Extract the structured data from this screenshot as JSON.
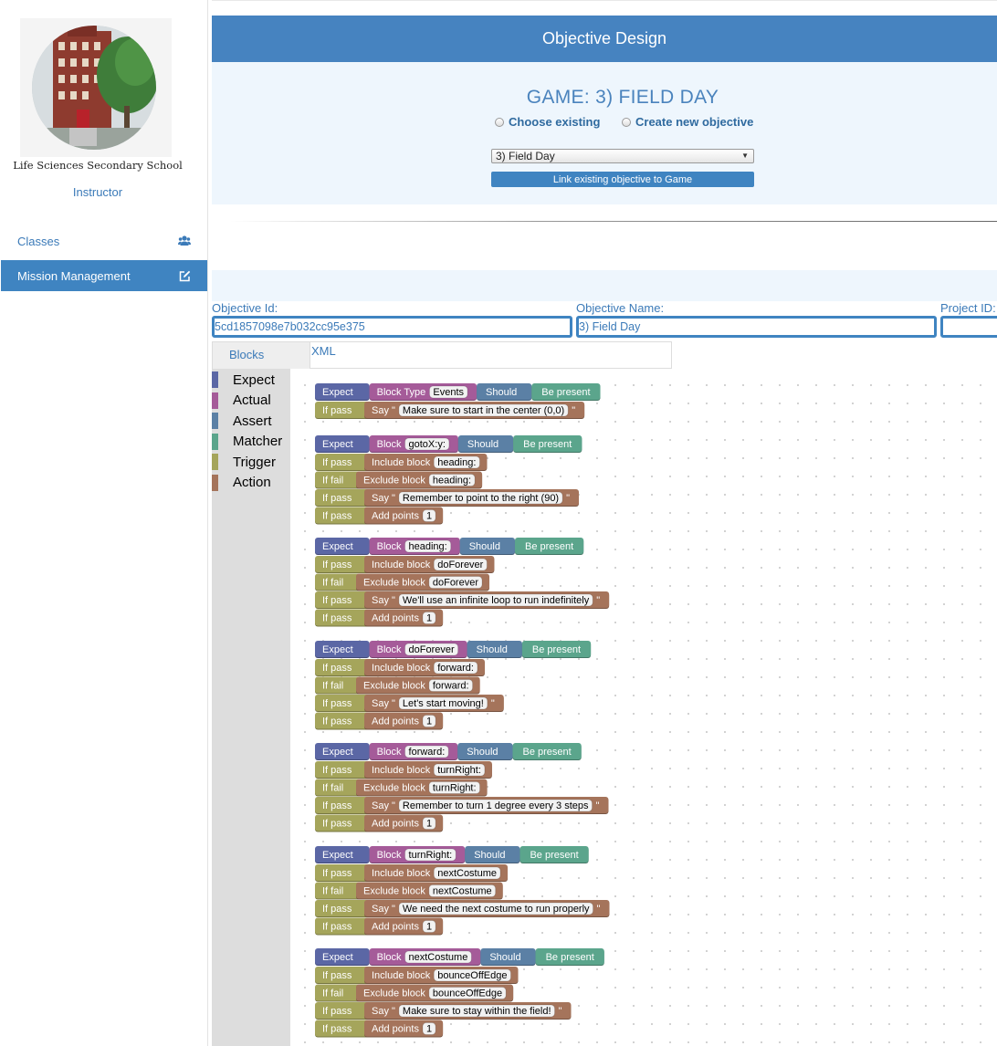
{
  "sidebar": {
    "school_name": "Life Sciences Secondary School",
    "role": "Instructor",
    "nav": [
      {
        "label": "Classes",
        "icon": "users-icon"
      },
      {
        "label": "Mission Management",
        "icon": "edit-icon"
      }
    ]
  },
  "panel": {
    "title": "Objective Design",
    "game_title": "GAME: 3) FIELD DAY",
    "radio_choose": "Choose existing",
    "radio_create": "Create new objective",
    "select_value": "3) Field Day",
    "link_button": "Link existing objective to Game"
  },
  "fields": {
    "objective_id_label": "Objective Id:",
    "objective_id_value": "5cd1857098e7b032cc95e375",
    "objective_name_label": "Objective Name:",
    "objective_name_value": "3) Field Day",
    "project_id_label": "Project ID:",
    "project_id_value": ""
  },
  "tabs": {
    "blocks": "Blocks",
    "xml": "XML"
  },
  "toolbox": [
    {
      "label": "Expect",
      "color": "#5b67a5"
    },
    {
      "label": "Actual",
      "color": "#a55b99"
    },
    {
      "label": "Assert",
      "color": "#5b80a5"
    },
    {
      "label": "Matcher",
      "color": "#5ba58c"
    },
    {
      "label": "Trigger",
      "color": "#a5a55b"
    },
    {
      "label": "Action",
      "color": "#a5745b"
    }
  ],
  "colors": {
    "expect": "#5b67a5",
    "actual": "#a55b99",
    "assert": "#5b80a5",
    "matcher": "#5ba58c",
    "trigger": "#a5a55b",
    "action": "#a5745b",
    "primary": "#3f84c1"
  },
  "blocks": {
    "labels": {
      "expect": "Expect",
      "should": "Should",
      "matcher": "Be present",
      "if_pass": "If pass",
      "if_fail": "If fail",
      "include": "Include block",
      "exclude": "Exclude block",
      "say": "Say",
      "add_points": "Add points"
    },
    "groups": [
      {
        "actual_label": "Block Type",
        "actual_field": "Events",
        "rows": [
          {
            "trigger": "pass",
            "action": "say",
            "value": "Make sure to start in the center (0,0)"
          }
        ]
      },
      {
        "actual_label": "Block",
        "actual_field": "gotoX:y:",
        "rows": [
          {
            "trigger": "pass",
            "action": "include",
            "value": "heading:"
          },
          {
            "trigger": "fail",
            "action": "exclude",
            "value": "heading:"
          },
          {
            "trigger": "pass",
            "action": "say",
            "value": "Remember to point to the right (90)"
          },
          {
            "trigger": "pass",
            "action": "points",
            "value": "1"
          }
        ]
      },
      {
        "actual_label": "Block",
        "actual_field": "heading:",
        "rows": [
          {
            "trigger": "pass",
            "action": "include",
            "value": "doForever"
          },
          {
            "trigger": "fail",
            "action": "exclude",
            "value": "doForever"
          },
          {
            "trigger": "pass",
            "action": "say",
            "value": "We'll use an infinite loop to run indefinitely"
          },
          {
            "trigger": "pass",
            "action": "points",
            "value": "1"
          }
        ]
      },
      {
        "actual_label": "Block",
        "actual_field": "doForever",
        "rows": [
          {
            "trigger": "pass",
            "action": "include",
            "value": "forward:"
          },
          {
            "trigger": "fail",
            "action": "exclude",
            "value": "forward:"
          },
          {
            "trigger": "pass",
            "action": "say",
            "value": "Let's start moving!"
          },
          {
            "trigger": "pass",
            "action": "points",
            "value": "1"
          }
        ]
      },
      {
        "actual_label": "Block",
        "actual_field": "forward:",
        "rows": [
          {
            "trigger": "pass",
            "action": "include",
            "value": "turnRight:"
          },
          {
            "trigger": "fail",
            "action": "exclude",
            "value": "turnRight:"
          },
          {
            "trigger": "pass",
            "action": "say",
            "value": "Remember to turn 1 degree every 3 steps"
          },
          {
            "trigger": "pass",
            "action": "points",
            "value": "1"
          }
        ]
      },
      {
        "actual_label": "Block",
        "actual_field": "turnRight:",
        "rows": [
          {
            "trigger": "pass",
            "action": "include",
            "value": "nextCostume"
          },
          {
            "trigger": "fail",
            "action": "exclude",
            "value": "nextCostume"
          },
          {
            "trigger": "pass",
            "action": "say",
            "value": "We need the next costume to run properly"
          },
          {
            "trigger": "pass",
            "action": "points",
            "value": "1"
          }
        ]
      },
      {
        "actual_label": "Block",
        "actual_field": "nextCostume",
        "rows": [
          {
            "trigger": "pass",
            "action": "include",
            "value": "bounceOffEdge"
          },
          {
            "trigger": "fail",
            "action": "exclude",
            "value": "bounceOffEdge"
          },
          {
            "trigger": "pass",
            "action": "say",
            "value": "Make sure to stay within the field!"
          },
          {
            "trigger": "pass",
            "action": "points",
            "value": "1"
          }
        ]
      }
    ]
  }
}
